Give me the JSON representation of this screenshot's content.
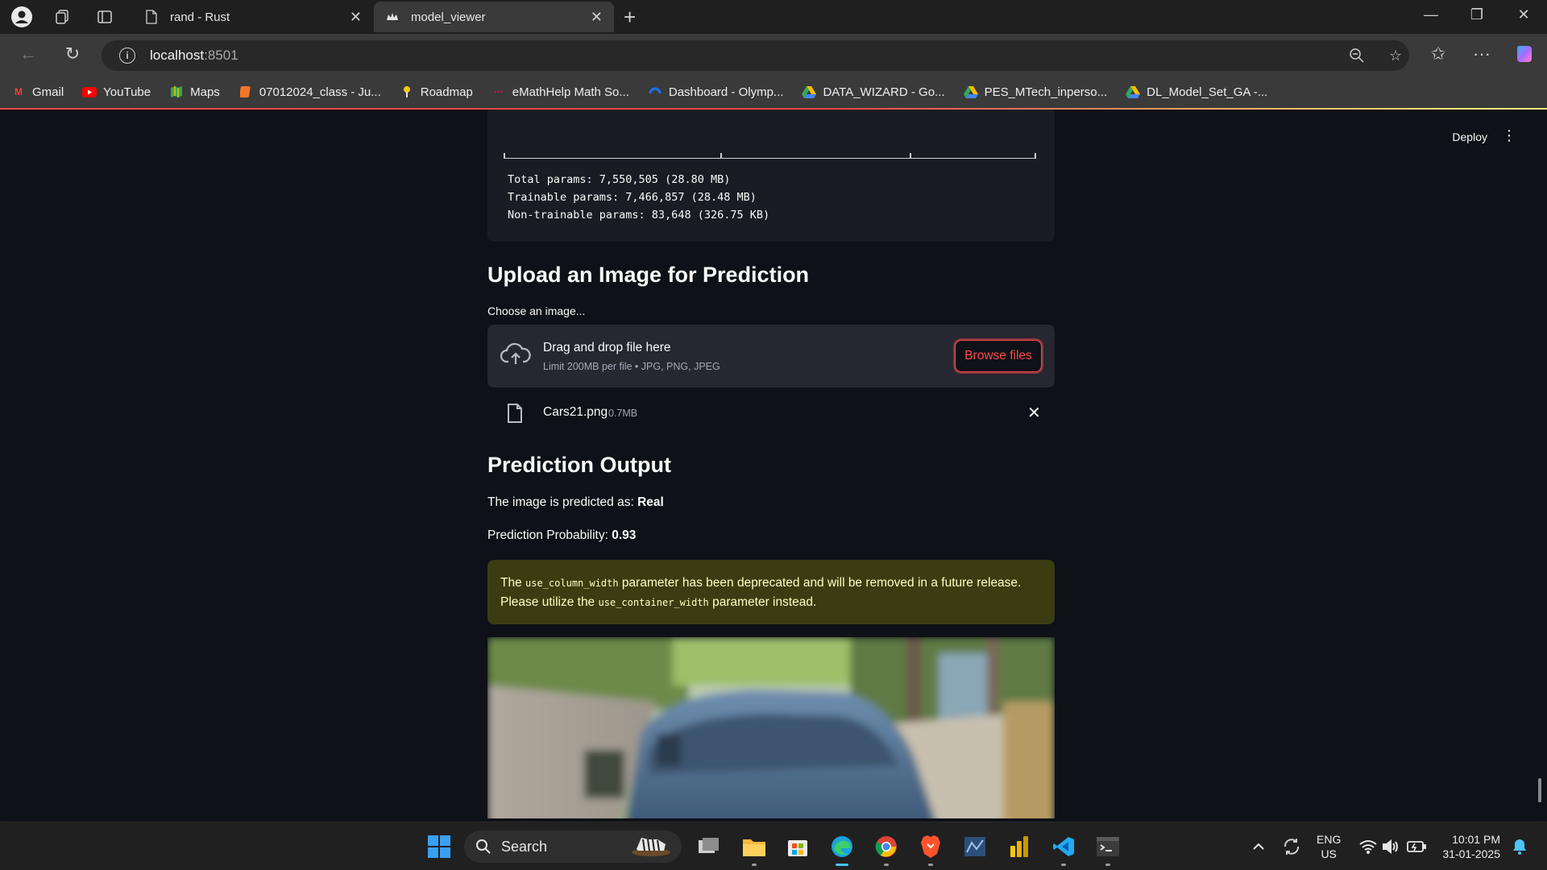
{
  "browser": {
    "tabs": [
      {
        "title": "rand - Rust",
        "active": false
      },
      {
        "title": "model_viewer",
        "active": true
      }
    ],
    "url_host": "localhost",
    "url_port": ":8501",
    "bookmarks": [
      {
        "label": "Gmail",
        "icon": "gmail-icon",
        "color": "#ea4335"
      },
      {
        "label": "YouTube",
        "icon": "youtube-icon",
        "color": "#ff0000"
      },
      {
        "label": "Maps",
        "icon": "maps-icon",
        "color": "#34a853"
      },
      {
        "label": "07012024_class - Ju...",
        "icon": "jupyter-icon",
        "color": "#f37626"
      },
      {
        "label": "Roadmap",
        "icon": "roadmap-icon",
        "color": "#f5c518"
      },
      {
        "label": "eMathHelp Math So...",
        "icon": "emathhelp-icon",
        "color": "#c2185b"
      },
      {
        "label": "Dashboard - Olymp...",
        "icon": "olympus-icon",
        "color": "#1a73e8"
      },
      {
        "label": "DATA_WIZARD - Go...",
        "icon": "google-drive-icon",
        "color": "#fbbc04"
      },
      {
        "label": "PES_MTech_inperso...",
        "icon": "google-drive-icon",
        "color": "#fbbc04"
      },
      {
        "label": "DL_Model_Set_GA -...",
        "icon": "google-drive-icon",
        "color": "#fbbc04"
      }
    ]
  },
  "app": {
    "deploy_label": "Deploy",
    "summary": {
      "total_params": "Total params: 7,550,505 (28.80 MB)",
      "trainable_params": "Trainable params: 7,466,857 (28.48 MB)",
      "non_trainable_params": "Non-trainable params: 83,648 (326.75 KB)"
    },
    "upload_heading": "Upload an Image for Prediction",
    "uploader_label": "Choose an image...",
    "dropzone_title": "Drag and drop file here",
    "dropzone_limit": "Limit 200MB per file • JPG, PNG, JPEG",
    "browse_label": "Browse files",
    "file_name": "Cars21.png",
    "file_size": "0.7MB",
    "output_heading": "Prediction Output",
    "prediction_prefix": "The image is predicted as: ",
    "prediction_value": "Real",
    "probability_prefix": "Prediction Probability: ",
    "probability_value": "0.93",
    "warning": {
      "part1": "The ",
      "code1": "use_column_width",
      "part2": " parameter has been deprecated and will be removed in a future release. Please utilize the ",
      "code2": "use_container_width",
      "part3": " parameter instead."
    },
    "accent_color": "#ff4b4b",
    "warning_bg": "#3c3c12"
  },
  "taskbar": {
    "search_label": "Search",
    "lang_line1": "ENG",
    "lang_line2": "US",
    "time": "10:01 PM",
    "date": "31-01-2025"
  }
}
